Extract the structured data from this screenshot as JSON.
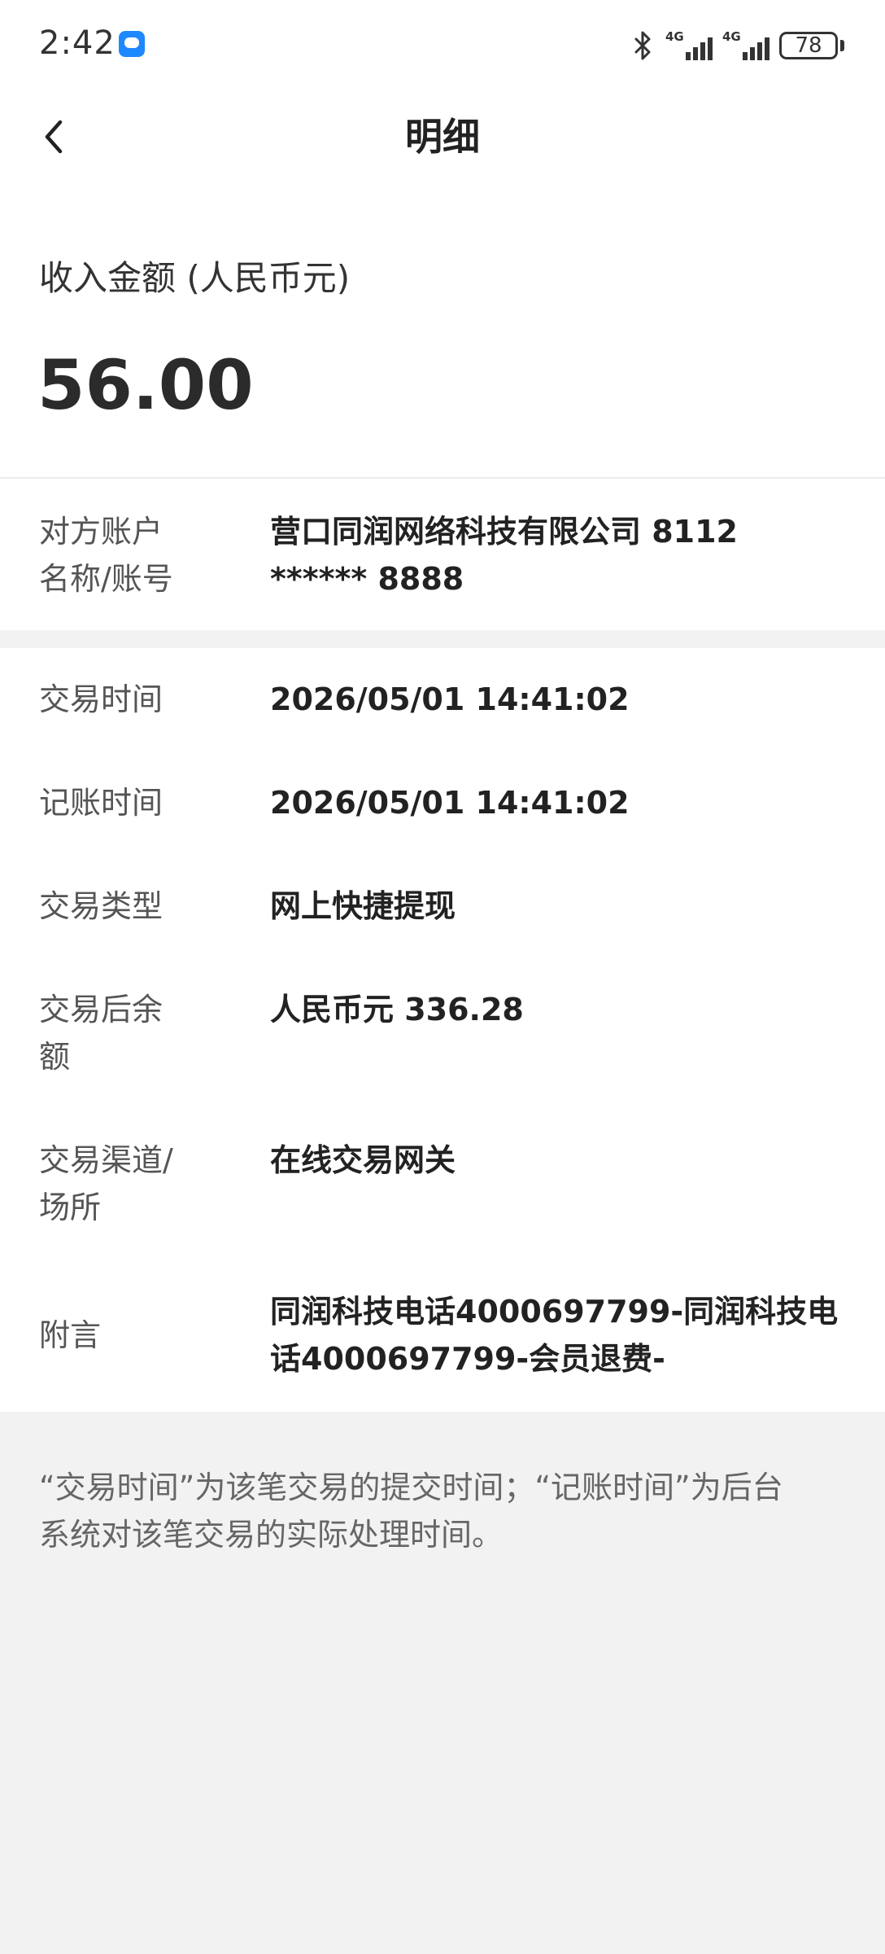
{
  "status_bar": {
    "time": "2:42",
    "network_1": "4G",
    "network_2": "4G",
    "battery": "78"
  },
  "header": {
    "title": "明细"
  },
  "summary": {
    "amount_label": "收入金额 (人民币元)",
    "amount": "56.00"
  },
  "counterparty": {
    "label_line1": "对方账户",
    "label_line2": "名称/账号",
    "value_line1": "营口同润网络科技有限公司 8112",
    "value_line2": "****** 8888"
  },
  "details": [
    {
      "label_line1": "交易时间",
      "label_line2": "",
      "value_line1": "2026/05/01 14:41:02",
      "value_line2": ""
    },
    {
      "label_line1": "记账时间",
      "label_line2": "",
      "value_line1": "2026/05/01 14:41:02",
      "value_line2": ""
    },
    {
      "label_line1": "交易类型",
      "label_line2": "",
      "value_line1": "网上快捷提现",
      "value_line2": ""
    },
    {
      "label_line1": "交易后余",
      "label_line2": "额",
      "value_line1": "人民币元 336.28",
      "value_line2": ""
    },
    {
      "label_line1": "交易渠道/",
      "label_line2": "场所",
      "value_line1": "在线交易网关",
      "value_line2": ""
    },
    {
      "label_line1": "附言",
      "label_line2": "",
      "value_line1": "同润科技电话4000697799-同润科技电",
      "value_line2": "话4000697799-会员退费-"
    }
  ],
  "footnote": {
    "line1": "“交易时间”为该笔交易的提交时间；“记账时间”为后台",
    "line2": "系统对该笔交易的实际处理时间。"
  }
}
